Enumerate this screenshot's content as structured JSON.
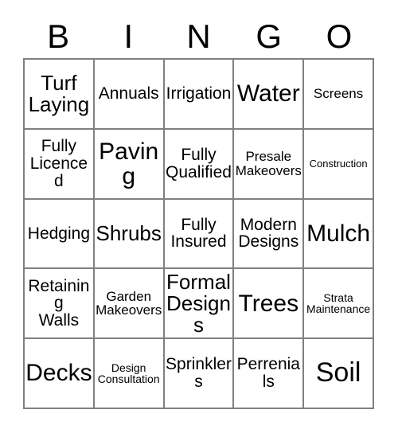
{
  "card": {
    "header_letters": [
      "B",
      "I",
      "N",
      "G",
      "O"
    ],
    "colors": {
      "grid_line": "#808080",
      "text": "#000000",
      "background": "#ffffff"
    },
    "rows": [
      [
        {
          "label": "Turf\nLaying",
          "size": "lg"
        },
        {
          "label": "Annuals",
          "size": "md"
        },
        {
          "label": "Irrigation",
          "size": "md"
        },
        {
          "label": "Water",
          "size": "xl"
        },
        {
          "label": "Screens",
          "size": "sm"
        }
      ],
      [
        {
          "label": "Fully\nLicenced",
          "size": "md"
        },
        {
          "label": "Paving",
          "size": "xl"
        },
        {
          "label": "Fully\nQualified",
          "size": "md"
        },
        {
          "label": "Presale\nMakeovers",
          "size": "sm"
        },
        {
          "label": "Construction",
          "size": "xxs"
        }
      ],
      [
        {
          "label": "Hedging",
          "size": "md"
        },
        {
          "label": "Shrubs",
          "size": "lg"
        },
        {
          "label": "Fully\nInsured",
          "size": "md"
        },
        {
          "label": "Modern\nDesigns",
          "size": "md"
        },
        {
          "label": "Mulch",
          "size": "xl"
        }
      ],
      [
        {
          "label": "Retaining\nWalls",
          "size": "md"
        },
        {
          "label": "Garden\nMakeovers",
          "size": "sm"
        },
        {
          "label": "Formal\nDesigns",
          "size": "lg"
        },
        {
          "label": "Trees",
          "size": "xl"
        },
        {
          "label": "Strata\nMaintenance",
          "size": "xs"
        }
      ],
      [
        {
          "label": "Decks",
          "size": "xl"
        },
        {
          "label": "Design\nConsultation",
          "size": "xs"
        },
        {
          "label": "Sprinklers",
          "size": "md"
        },
        {
          "label": "Perrenials",
          "size": "md"
        },
        {
          "label": "Soil",
          "size": "xxl"
        }
      ]
    ]
  }
}
